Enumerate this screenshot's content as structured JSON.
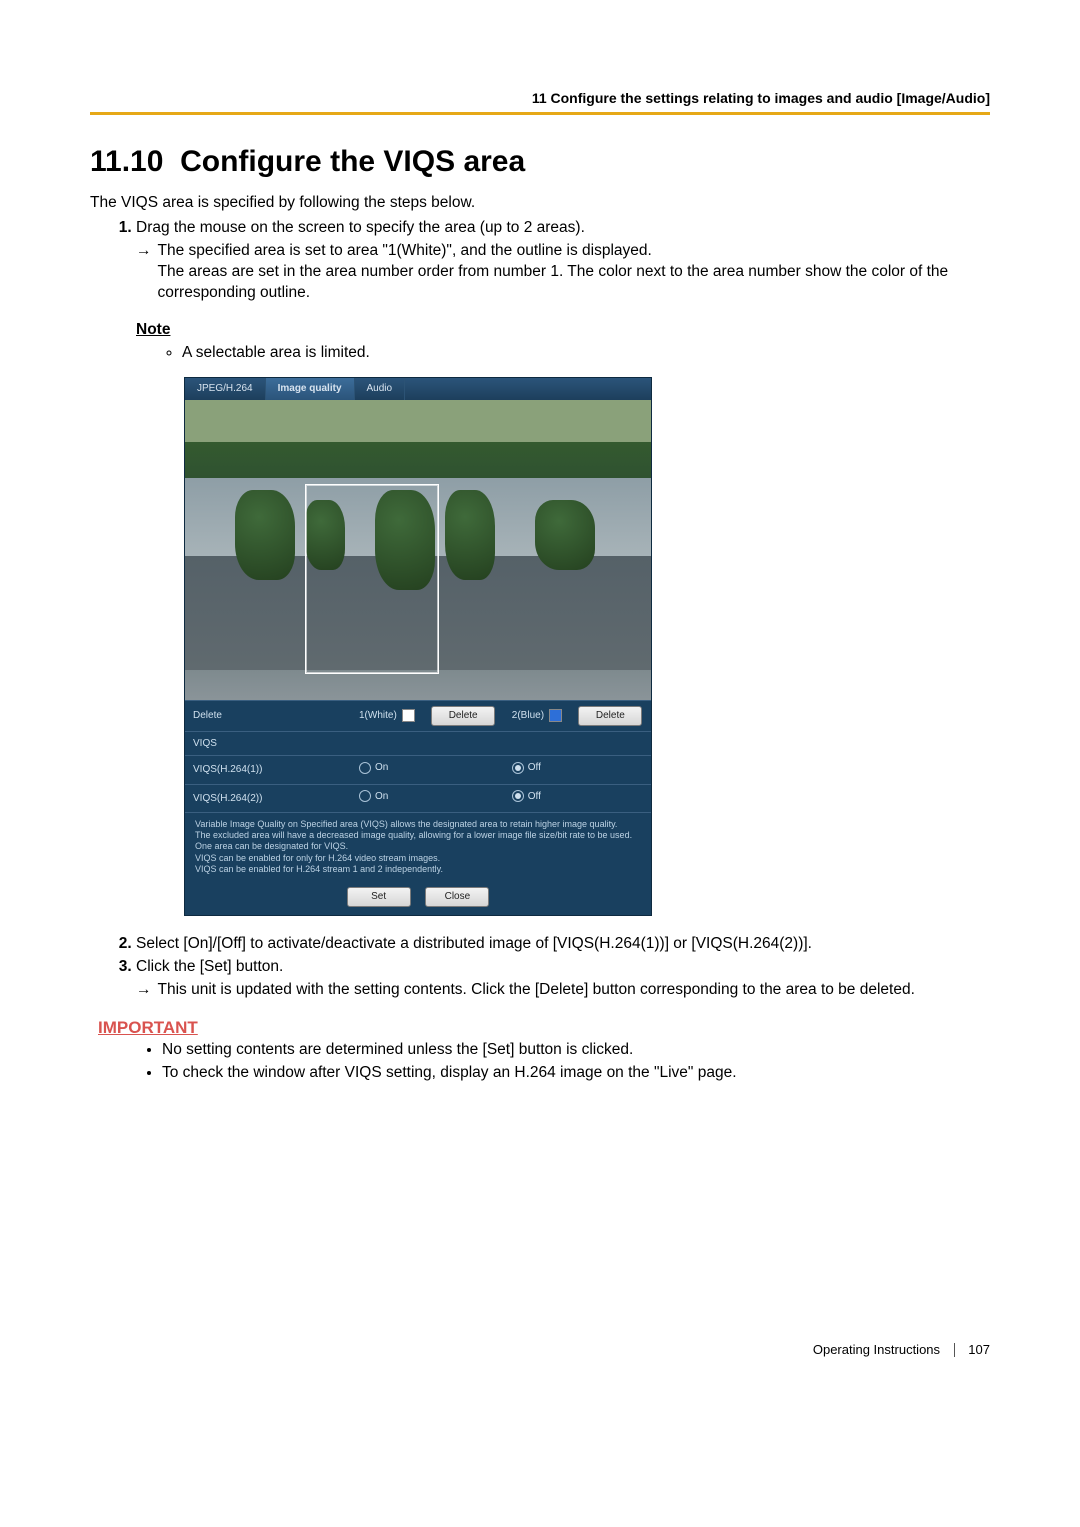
{
  "header": {
    "breadcrumb": "11 Configure the settings relating to images and audio [Image/Audio]"
  },
  "section": {
    "number": "11.10",
    "title": "Configure the VIQS area"
  },
  "intro": "The VIQS area is specified by following the steps below.",
  "steps": {
    "s1": {
      "text": "Drag the mouse on the screen to specify the area (up to 2 areas).",
      "arrow_a": "The specified area is set to area \"1(White)\", and the outline is displayed.",
      "arrow_b": "The areas are set in the area number order from number 1. The color next to the area number show the color of the corresponding outline."
    },
    "s2": {
      "text": "Select [On]/[Off] to activate/deactivate a distributed image of [VIQS(H.264(1))] or [VIQS(H.264(2))]."
    },
    "s3": {
      "text": "Click the [Set] button.",
      "arrow": "This unit is updated with the setting contents. Click the [Delete] button corresponding to the area to be deleted."
    }
  },
  "note": {
    "label": "Note",
    "item": "A selectable area is limited."
  },
  "important": {
    "label": "IMPORTANT",
    "i1": "No setting contents are determined unless the [Set] button is clicked.",
    "i2": "To check the window after VIQS setting, display an H.264 image on the \"Live\" page."
  },
  "ui": {
    "tabs": {
      "jpeg": "JPEG/H.264",
      "quality": "Image quality",
      "audio": "Audio"
    },
    "rows": {
      "delete_label": "Delete",
      "area1_label": "1(White)",
      "area2_label": "2(Blue)",
      "delete_btn": "Delete",
      "viqs_label": "VIQS",
      "viqs1_label": "VIQS(H.264(1))",
      "viqs2_label": "VIQS(H.264(2))",
      "on": "On",
      "off": "Off"
    },
    "help": {
      "l1": "Variable Image Quality on Specified area (VIQS) allows the designated area to retain higher image quality.",
      "l2": "The excluded area will have a decreased image quality, allowing for a lower image file size/bit rate to be used.",
      "l3": "One area can be designated for VIQS.",
      "l4": "VIQS can be enabled for only for H.264 video stream images.",
      "l5": "VIQS can be enabled for H.264 stream 1 and 2 independently."
    },
    "buttons": {
      "set": "Set",
      "close": "Close"
    }
  },
  "footer": {
    "doc": "Operating Instructions",
    "page": "107"
  },
  "arrow_sym": "→"
}
